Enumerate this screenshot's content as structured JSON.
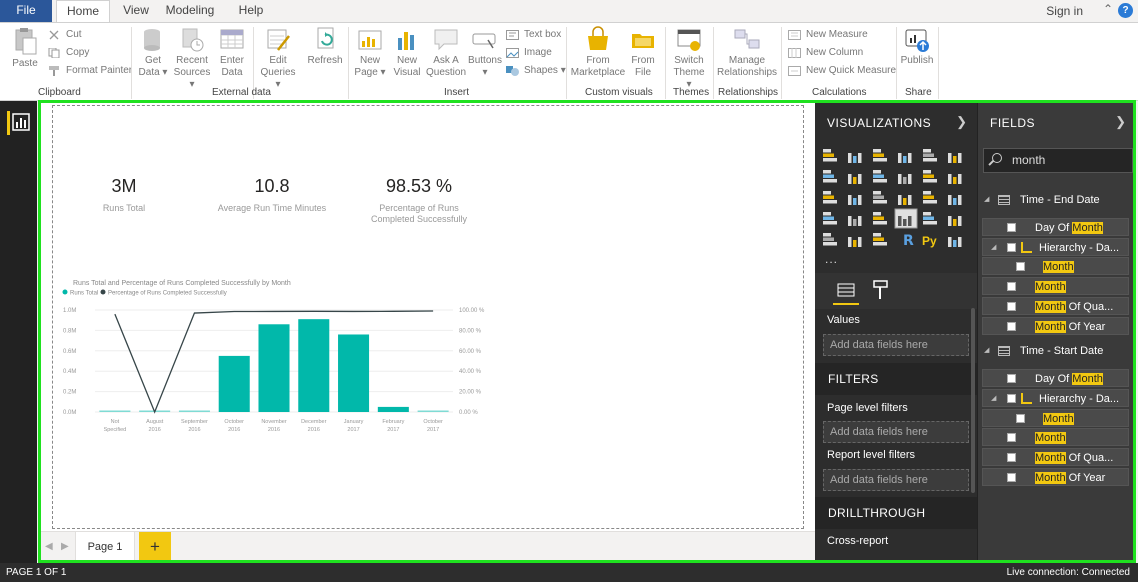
{
  "ribbon_tabs": {
    "file": "File",
    "home": "Home",
    "view": "View",
    "modeling": "Modeling",
    "help": "Help"
  },
  "account": {
    "signin": "Sign in"
  },
  "ribbon": {
    "clipboard": {
      "paste": "Paste",
      "cut": "Cut",
      "copy": "Copy",
      "format_painter": "Format Painter",
      "label": "Clipboard"
    },
    "external_data": {
      "get_data": [
        "Get",
        "Data ▾"
      ],
      "recent_sources": [
        "Recent",
        "Sources ▾"
      ],
      "enter_data": [
        "Enter",
        "Data"
      ],
      "edit_queries": [
        "Edit",
        "Queries ▾"
      ],
      "refresh": "Refresh",
      "label": "External data"
    },
    "insert": {
      "new_page": [
        "New",
        "Page ▾"
      ],
      "new_visual": [
        "New",
        "Visual"
      ],
      "ask_question": [
        "Ask A",
        "Question"
      ],
      "buttons": [
        "Buttons",
        "▾"
      ],
      "text_box": "Text box",
      "image": "Image",
      "shapes": "Shapes ▾",
      "label": "Insert"
    },
    "custom_visuals": {
      "from_marketplace": [
        "From",
        "Marketplace"
      ],
      "from_file": [
        "From",
        "File"
      ],
      "label": "Custom visuals"
    },
    "themes": {
      "switch_theme": [
        "Switch",
        "Theme ▾"
      ],
      "label": "Themes"
    },
    "relationships": {
      "manage": [
        "Manage",
        "Relationships"
      ],
      "label": "Relationships"
    },
    "calculations": {
      "new_measure": "New Measure",
      "new_column": "New Column",
      "new_quick_measure": "New Quick Measure",
      "label": "Calculations"
    },
    "share": {
      "publish": "Publish",
      "label": "Share"
    }
  },
  "cards": [
    {
      "value": "3M",
      "label": "Runs Total"
    },
    {
      "value": "10.8",
      "label": "Average Run Time Minutes"
    },
    {
      "value": "98.53 %",
      "label": "Percentage of Runs Completed Successfully"
    }
  ],
  "chart_data": {
    "type": "bar",
    "title": "Runs Total and Percentage of Runs Completed Successfully by Month",
    "legend": [
      "Runs Total",
      "Percentage of Runs Completed Successfully"
    ],
    "legend_placement": "top-left",
    "categories": [
      [
        "Not",
        "Specified"
      ],
      [
        "August",
        "2016"
      ],
      [
        "September",
        "2016"
      ],
      [
        "October",
        "2016"
      ],
      [
        "November",
        "2016"
      ],
      [
        "December",
        "2016"
      ],
      [
        "January",
        "2017"
      ],
      [
        "February",
        "2017"
      ],
      [
        "October",
        "2017"
      ]
    ],
    "series": [
      {
        "name": "Runs Total",
        "kind": "bar",
        "axis": "left",
        "values": [
          0.01,
          0.0,
          0.01,
          0.55,
          0.86,
          0.91,
          0.76,
          0.05,
          0.01
        ]
      },
      {
        "name": "Percentage of Runs Completed Successfully",
        "kind": "line",
        "axis": "right",
        "values": [
          96,
          0,
          97,
          98.5,
          98.6,
          98.7,
          98.6,
          98.7,
          99
        ]
      }
    ],
    "y_left_ticks": [
      "0.0M",
      "0.2M",
      "0.4M",
      "0.6M",
      "0.8M",
      "1.0M"
    ],
    "y_right_ticks": [
      "0.00 %",
      "20.00 %",
      "40.00 %",
      "60.00 %",
      "80.00 %",
      "100.00 %"
    ],
    "ylim_left": [
      0,
      1.0
    ],
    "ylim_right": [
      0,
      100
    ],
    "colors": {
      "bar": "#01b8aa",
      "line": "#374649",
      "baseline_bar": "#7fdbd4"
    }
  },
  "page_tabs": {
    "page1": "Page 1",
    "add": "+"
  },
  "visualizations": {
    "title": "VISUALIZATIONS",
    "more": "...",
    "values_label": "Values",
    "add_fields": "Add data fields here",
    "filters_title": "FILTERS",
    "page_filters": "Page level filters",
    "page_add": "Add data fields here",
    "report_filters": "Report level filters",
    "report_add": "Add data fields here",
    "drillthrough_title": "DRILLTHROUGH",
    "cross_report": "Cross-report",
    "r_icon": "R",
    "py_icon": "Py"
  },
  "fields": {
    "title": "FIELDS",
    "search_value": "month",
    "tables": [
      {
        "name": "Time - End Date",
        "items": [
          {
            "pre": "Day Of ",
            "hl": "Month",
            "post": ""
          },
          {
            "pre": "Hierarchy - Da...",
            "hl": "",
            "post": "",
            "hier": true
          },
          {
            "pre": "",
            "hl": "Month",
            "post": "",
            "sub": true
          },
          {
            "pre": "",
            "hl": "Month",
            "post": ""
          },
          {
            "pre": "",
            "hl": "Month",
            "post": " Of Qua..."
          },
          {
            "pre": "",
            "hl": "Month",
            "post": " Of Year"
          }
        ]
      },
      {
        "name": "Time - Start Date",
        "items": [
          {
            "pre": "Day Of ",
            "hl": "Month",
            "post": ""
          },
          {
            "pre": "Hierarchy - Da...",
            "hl": "",
            "post": "",
            "hier": true
          },
          {
            "pre": "",
            "hl": "Month",
            "post": "",
            "sub": true
          },
          {
            "pre": "",
            "hl": "Month",
            "post": ""
          },
          {
            "pre": "",
            "hl": "Month",
            "post": " Of Qua..."
          },
          {
            "pre": "",
            "hl": "Month",
            "post": " Of Year"
          }
        ]
      }
    ]
  },
  "status": {
    "page": "PAGE 1 OF 1",
    "connection": "Live connection: Connected"
  }
}
